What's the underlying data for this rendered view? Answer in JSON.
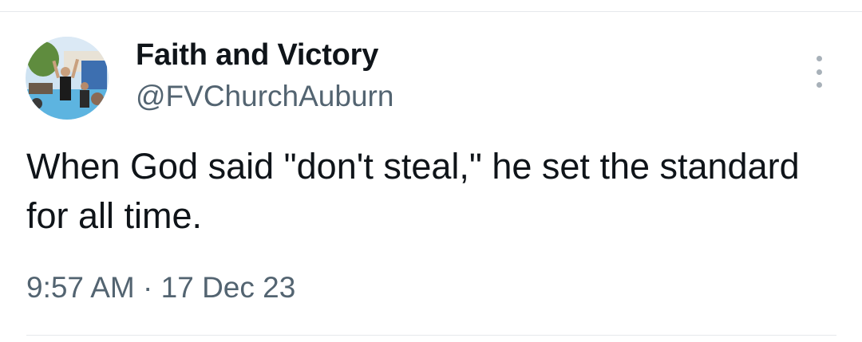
{
  "tweet": {
    "display_name": "Faith and Victory",
    "handle": "@FVChurchAuburn",
    "text": "When God said \"don't steal,\" he set the standard for all time.",
    "time": "9:57 AM",
    "separator": "·",
    "date": "17 Dec 23"
  },
  "icons": {
    "more": "more-options-icon"
  },
  "colors": {
    "primary_text": "#0f1419",
    "secondary_text": "#536471",
    "divider": "#e6e9ec"
  }
}
